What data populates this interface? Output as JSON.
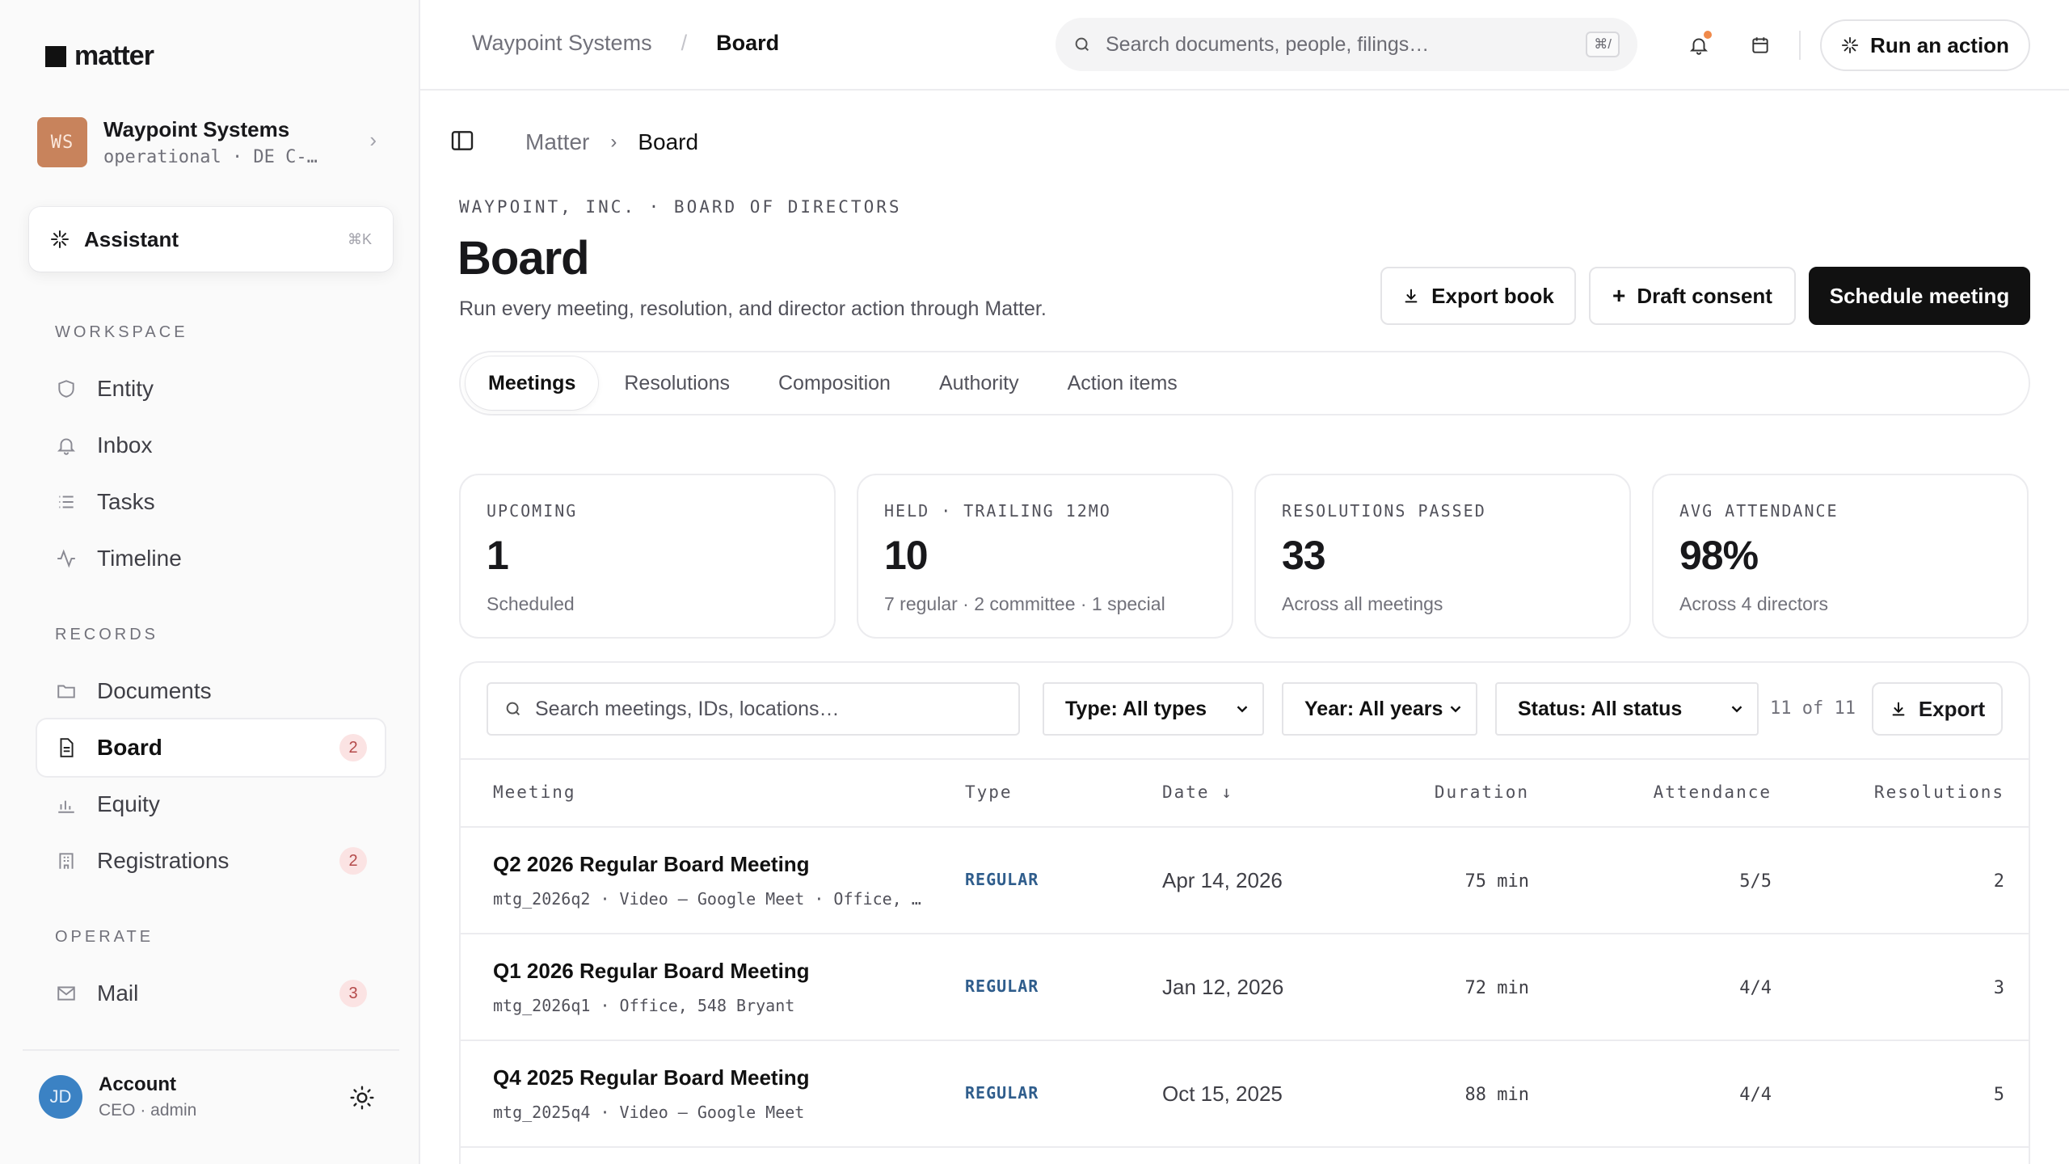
{
  "app": {
    "logo_text": "matter"
  },
  "org": {
    "initials": "WS",
    "name": "Waypoint Systems",
    "subtitle": "operational · DE C-…"
  },
  "assistant": {
    "label": "Assistant",
    "shortcut": "⌘K"
  },
  "sidebar": {
    "sections": [
      {
        "title": "WORKSPACE",
        "items": [
          {
            "label": "Entity",
            "icon": "shield-icon"
          },
          {
            "label": "Inbox",
            "icon": "bell-icon"
          },
          {
            "label": "Tasks",
            "icon": "list-icon"
          },
          {
            "label": "Timeline",
            "icon": "activity-icon"
          }
        ]
      },
      {
        "title": "RECORDS",
        "items": [
          {
            "label": "Documents",
            "icon": "folder-icon"
          },
          {
            "label": "Board",
            "icon": "document-icon",
            "badge": "2",
            "active": true
          },
          {
            "label": "Equity",
            "icon": "bar-chart-icon"
          },
          {
            "label": "Registrations",
            "icon": "building-icon",
            "badge": "2"
          }
        ]
      },
      {
        "title": "OPERATE",
        "items": [
          {
            "label": "Mail",
            "icon": "mail-icon",
            "badge": "3"
          }
        ]
      }
    ]
  },
  "account": {
    "initials": "JD",
    "name": "Account",
    "role": "CEO · admin"
  },
  "topbar": {
    "breadcrumb_root": "Waypoint Systems",
    "breadcrumb_separator": "/",
    "breadcrumb_current": "Board",
    "search_placeholder": "Search documents, people, filings…",
    "search_shortcut": "⌘/",
    "run_action_label": "Run an action"
  },
  "page": {
    "breadcrumb_root": "Matter",
    "breadcrumb_current": "Board",
    "eyebrow": "WAYPOINT, INC. · BOARD OF DIRECTORS",
    "title": "Board",
    "description": "Run every meeting, resolution, and director action through Matter.",
    "actions": {
      "export": "Export book",
      "draft": "Draft consent",
      "schedule": "Schedule meeting"
    },
    "tabs": [
      "Meetings",
      "Resolutions",
      "Composition",
      "Authority",
      "Action items"
    ],
    "active_tab": "Meetings"
  },
  "stats": [
    {
      "label": "UPCOMING",
      "value": "1",
      "sub": "Scheduled"
    },
    {
      "label": "HELD · TRAILING 12MO",
      "value": "10",
      "sub": "7 regular · 2 committee · 1 special"
    },
    {
      "label": "RESOLUTIONS PASSED",
      "value": "33",
      "sub": "Across all meetings"
    },
    {
      "label": "AVG ATTENDANCE",
      "value": "98%",
      "sub": "Across 4 directors"
    }
  ],
  "filters": {
    "search_placeholder": "Search meetings, IDs, locations…",
    "type": "Type: All types",
    "year": "Year: All years",
    "status": "Status: All status",
    "count": "11 of 11",
    "export": "Export"
  },
  "table": {
    "columns": {
      "meeting": "Meeting",
      "type": "Type",
      "date": "Date ↓",
      "duration": "Duration",
      "attendance": "Attendance",
      "resolutions": "Resolutions"
    },
    "rows": [
      {
        "name": "Q2 2026 Regular Board Meeting",
        "sub": "mtg_2026q2 · Video — Google Meet · Office, …",
        "type": "REGULAR",
        "date": "Apr 14, 2026",
        "duration": "75 min",
        "attendance": "5/5",
        "resolutions": "2"
      },
      {
        "name": "Q1 2026 Regular Board Meeting",
        "sub": "mtg_2026q1 · Office, 548 Bryant",
        "type": "REGULAR",
        "date": "Jan 12, 2026",
        "duration": "72 min",
        "attendance": "4/4",
        "resolutions": "3"
      },
      {
        "name": "Q4 2025 Regular Board Meeting",
        "sub": "mtg_2025q4 · Video — Google Meet",
        "type": "REGULAR",
        "date": "Oct 15, 2025",
        "duration": "88 min",
        "attendance": "4/4",
        "resolutions": "5"
      }
    ]
  }
}
